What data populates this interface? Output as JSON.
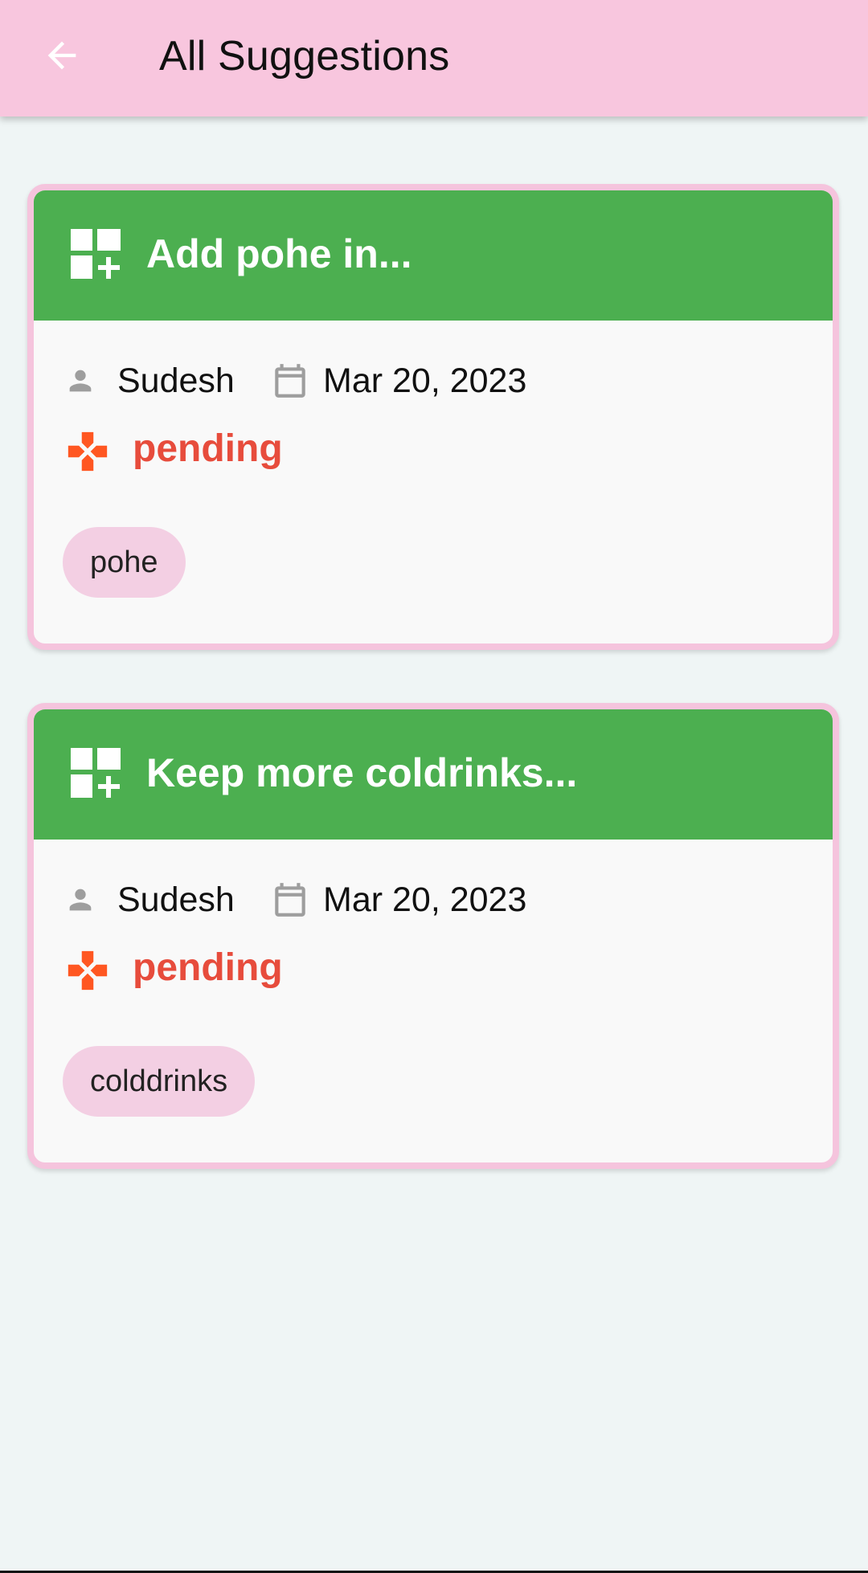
{
  "appbar": {
    "title": "All Suggestions",
    "back_icon": "arrow-back-icon",
    "background": "#f8c6de"
  },
  "suggestions": [
    {
      "title": "Add pohe in...",
      "header_icon": "dashboard-add-icon",
      "author": "Sudesh",
      "author_icon": "person-icon",
      "date": "Mar 20, 2023",
      "date_icon": "calendar-icon",
      "status": "pending",
      "status_icon": "gamepad-icon",
      "tag": "pohe"
    },
    {
      "title": "Keep more coldrinks...",
      "header_icon": "dashboard-add-icon",
      "author": "Sudesh",
      "author_icon": "person-icon",
      "date": "Mar 20, 2023",
      "date_icon": "calendar-icon",
      "status": "pending",
      "status_icon": "gamepad-icon",
      "tag": "colddrinks"
    }
  ],
  "colors": {
    "card_header": "#4caf50",
    "card_border": "#f5c4dd",
    "status_text": "#e74c3c",
    "status_icon": "#ff5722",
    "tag_chip": "#f3cfe3",
    "page_background": "#eff5f5"
  }
}
